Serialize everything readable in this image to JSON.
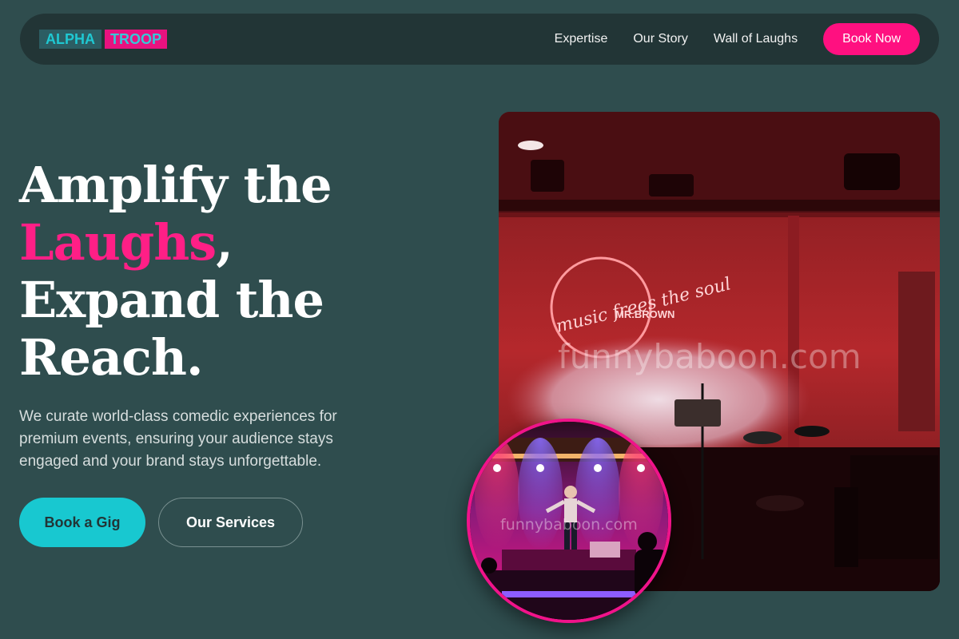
{
  "brand": {
    "part1": "ALPHA",
    "part2": "TROOP"
  },
  "nav": {
    "links": [
      "Expertise",
      "Our Story",
      "Wall of Laughs"
    ],
    "cta": "Book Now"
  },
  "hero": {
    "title_line1": "Amplify the",
    "title_highlight": "Laughs",
    "title_comma": ",",
    "title_line3": "Expand the",
    "title_line4": "Reach.",
    "description": "We curate world-class comedic experiences for premium events, ensuring your audience stays engaged and your brand stays unforgettable.",
    "primary_button": "Book a Gig",
    "secondary_button": "Our Services"
  },
  "images": {
    "main_watermark": "funnybaboon.com",
    "neon_sign_text": "music frees the soul",
    "neon_sign_sub": "MR.BROWN",
    "circle_watermark": "funnybaboon.com"
  },
  "colors": {
    "background": "#2f4d4e",
    "accent_pink": "#ff1080",
    "accent_cyan": "#18c8d0"
  }
}
